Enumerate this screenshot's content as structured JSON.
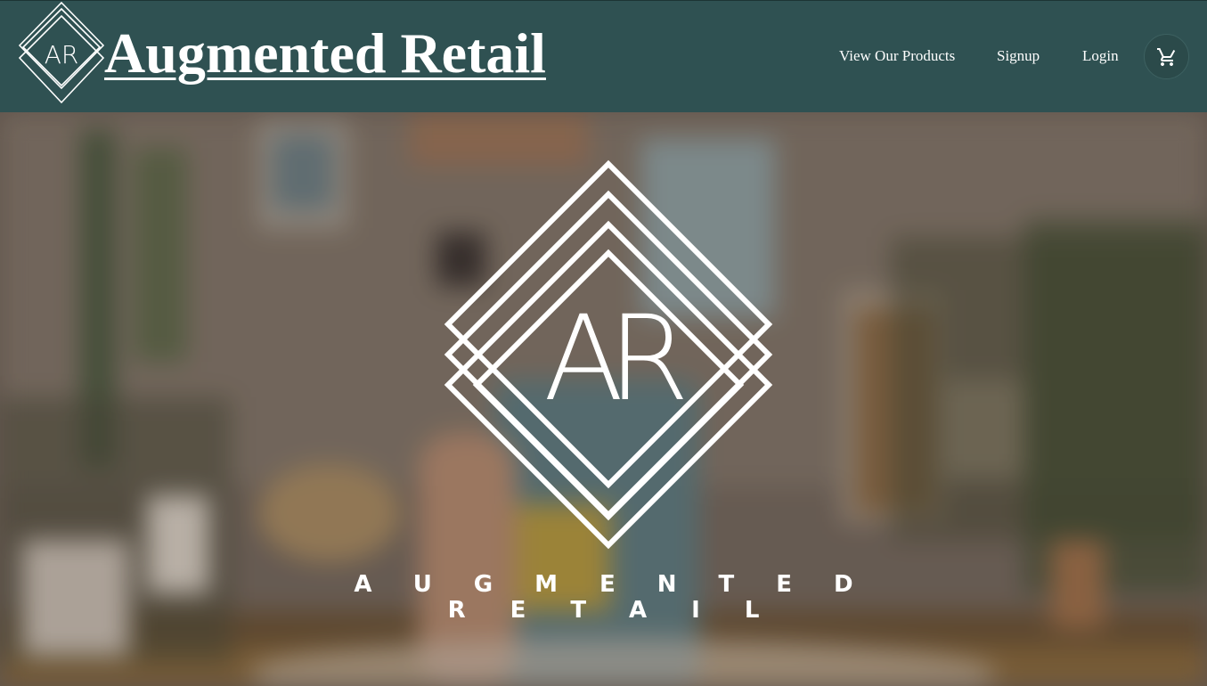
{
  "header": {
    "brand_title": "Augmented Retail",
    "logo_monogram": "AR",
    "nav": {
      "products": "View Our Products",
      "signup": "Signup",
      "login": "Login"
    },
    "cart_icon": "cart-icon"
  },
  "hero": {
    "logo_monogram": "AR",
    "tagline_line1": "AUGMENTED",
    "tagline_line2": "RETAIL",
    "background": "blurred-living-room-photo"
  },
  "colors": {
    "header_bg": "#2f5152",
    "text": "#ffffff"
  }
}
